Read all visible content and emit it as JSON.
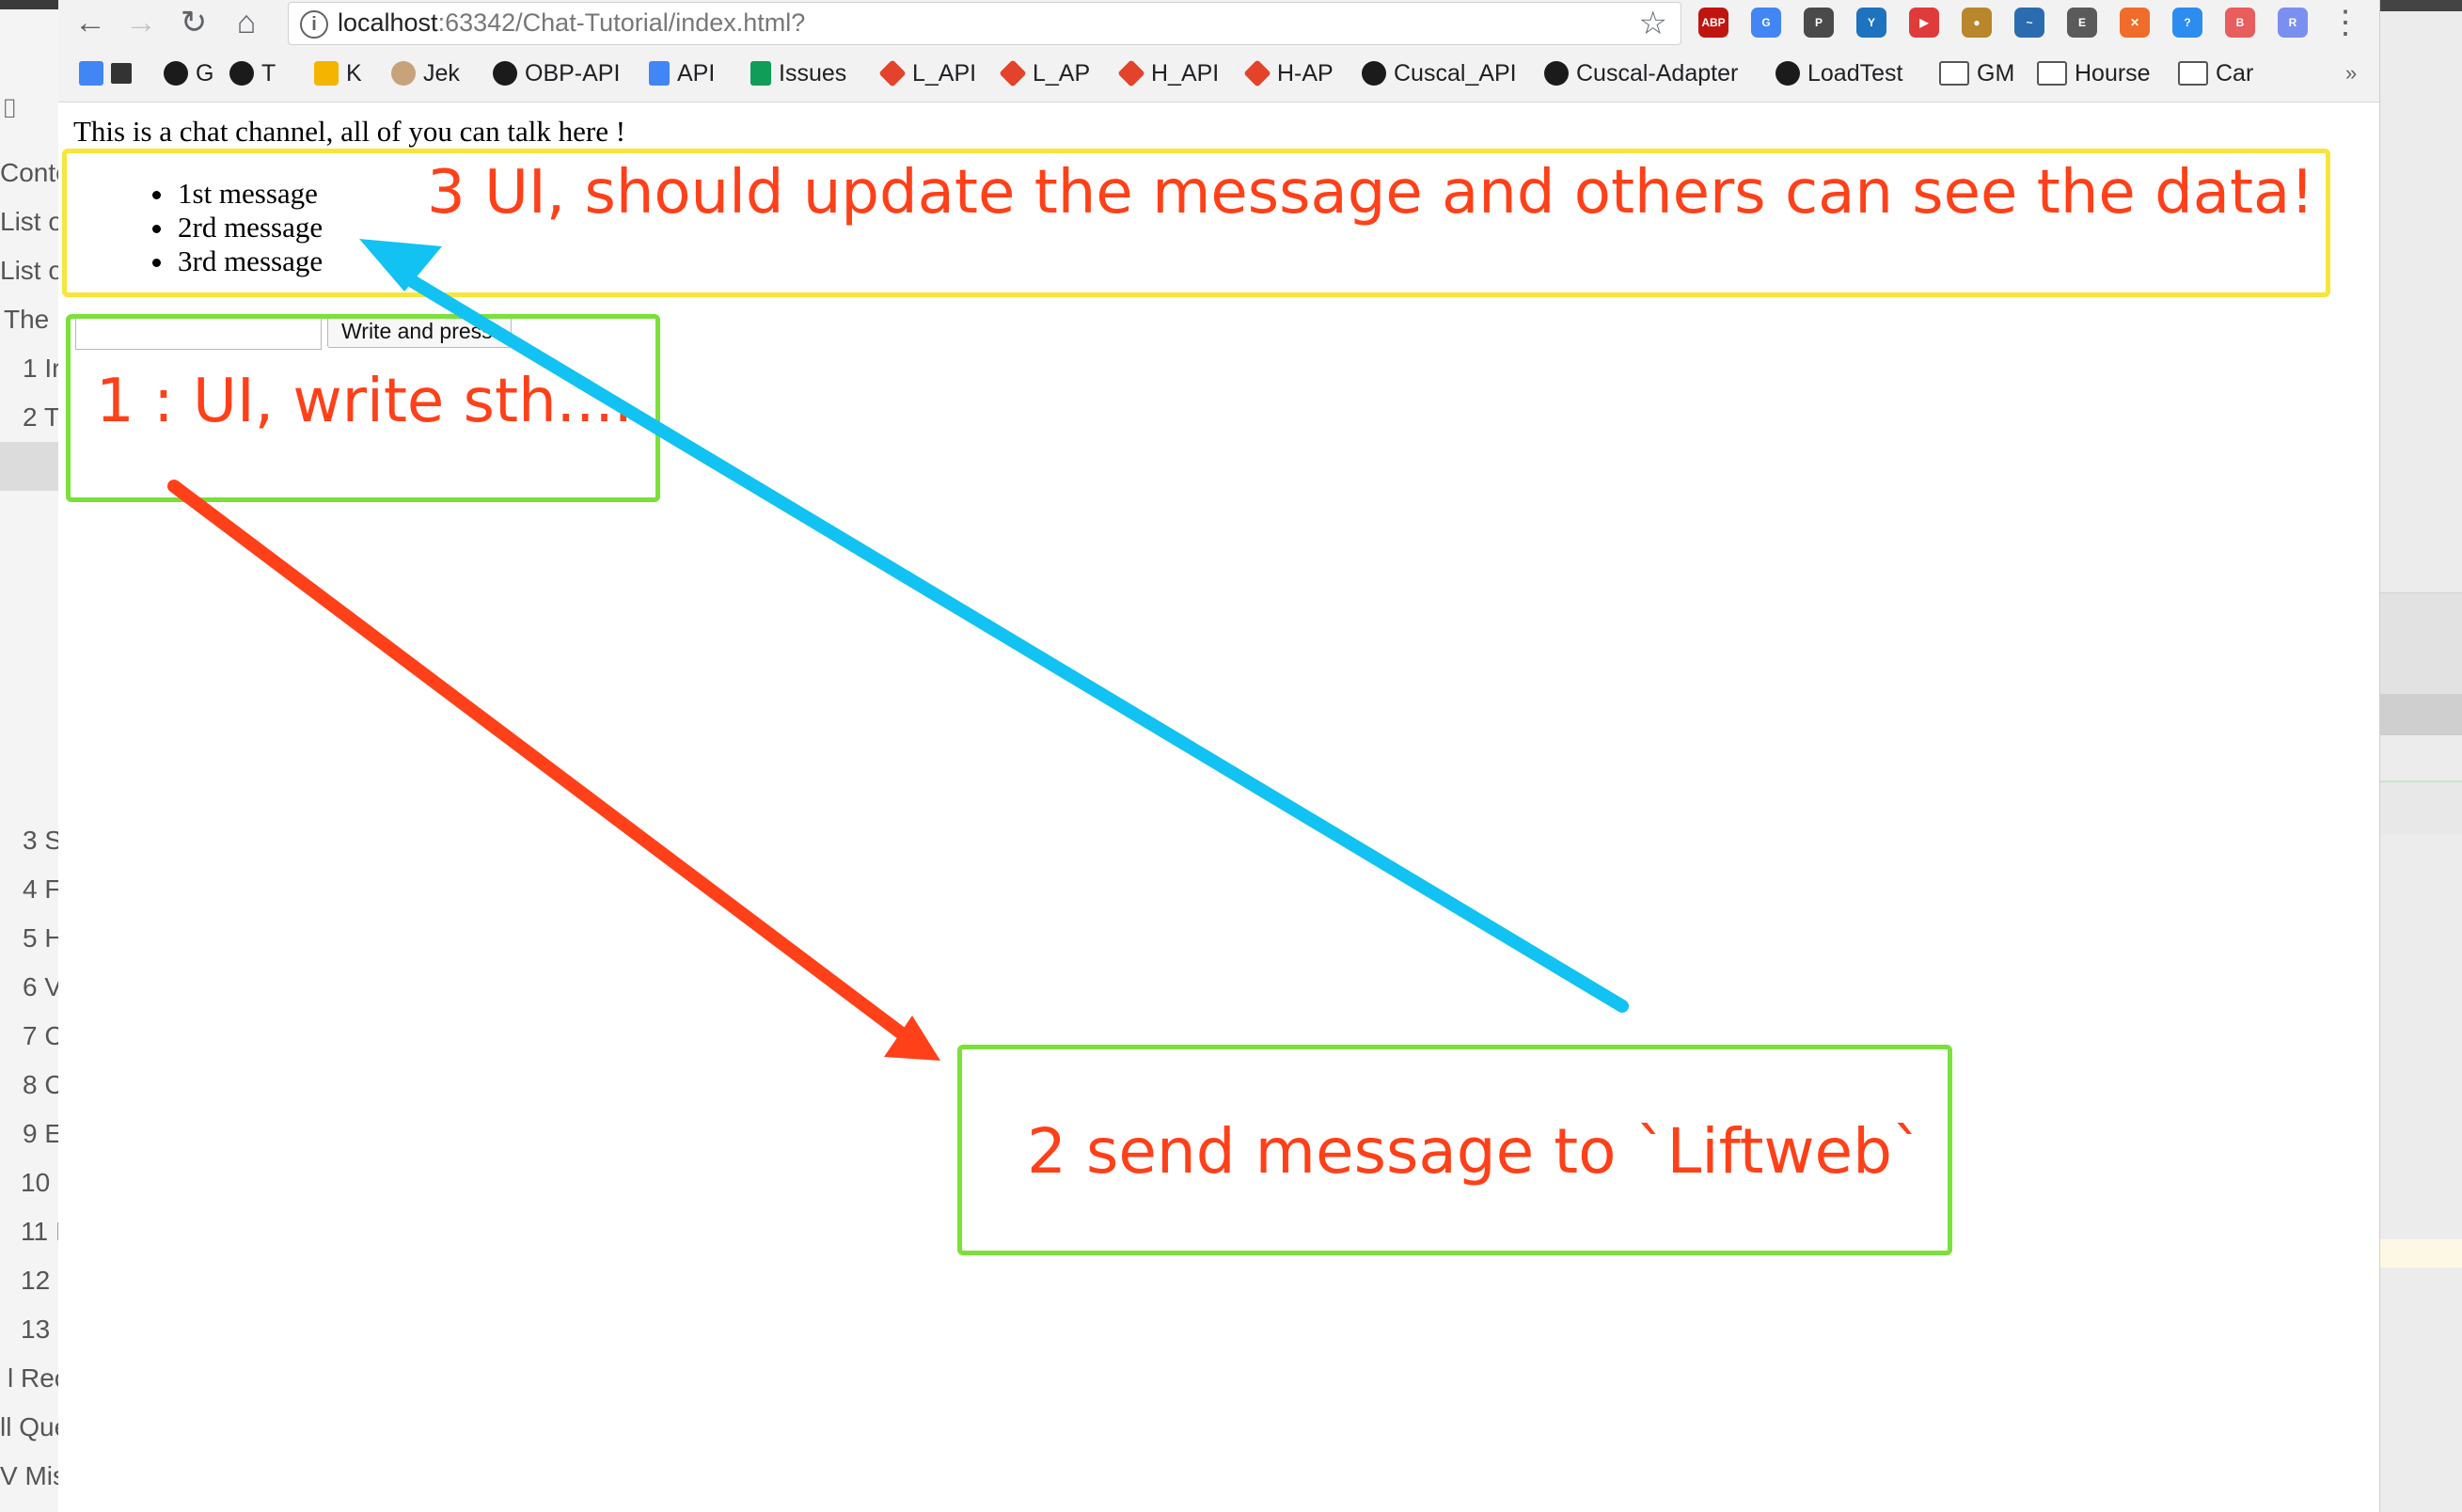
{
  "left_pane": {
    "items": [
      {
        "label": "Conte"
      },
      {
        "label": "List o"
      },
      {
        "label": "List o"
      },
      {
        "label": "The"
      },
      {
        "label": "1 Ir"
      },
      {
        "label": "2 T"
      },
      {
        "label": "3 S"
      },
      {
        "label": "4 F"
      },
      {
        "label": "5 H"
      },
      {
        "label": "6 V"
      },
      {
        "label": "7 C"
      },
      {
        "label": "8 C"
      },
      {
        "label": "9 E"
      },
      {
        "label": "10"
      },
      {
        "label": "11 I"
      },
      {
        "label": "12"
      },
      {
        "label": "13"
      },
      {
        "label": "l Reci"
      },
      {
        "label": "ll Que"
      },
      {
        "label": "V Mis"
      }
    ]
  },
  "browser": {
    "url_host": "localhost",
    "url_rest": ":63342/Chat-Tutorial/index.html?",
    "extensions": [
      {
        "label": "ABP",
        "color": "#c0150f"
      },
      {
        "label": "G",
        "color": "#4285f4"
      },
      {
        "label": "P",
        "color": "#4a4a4a"
      },
      {
        "label": "Y",
        "color": "#1e73be"
      },
      {
        "label": "▶",
        "color": "#e03b3b"
      },
      {
        "label": "●",
        "color": "#b8862b"
      },
      {
        "label": "~",
        "color": "#2b6cb0"
      },
      {
        "label": "E",
        "color": "#5a5a5a"
      },
      {
        "label": "✕",
        "color": "#ef6c2a"
      },
      {
        "label": "?",
        "color": "#2d8cf0"
      },
      {
        "label": "B",
        "color": "#e85d5d"
      },
      {
        "label": "R",
        "color": "#7b8ff0"
      }
    ],
    "bookmarks": [
      {
        "label": "",
        "icon": "translate-icon"
      },
      {
        "label": "G",
        "icon": "github-icon"
      },
      {
        "label": "T",
        "icon": "github-icon"
      },
      {
        "label": "K",
        "icon": "bulb-icon"
      },
      {
        "label": "Jek",
        "icon": "jenkins-icon"
      },
      {
        "label": "OBP-API",
        "icon": "github-icon"
      },
      {
        "label": "API",
        "icon": "docs-icon"
      },
      {
        "label": "Issues",
        "icon": "sheets-icon"
      },
      {
        "label": "L_API",
        "icon": "gitlab-icon"
      },
      {
        "label": "L_AP",
        "icon": "gitlab-icon"
      },
      {
        "label": "H_API",
        "icon": "gitlab-icon"
      },
      {
        "label": "H-AP",
        "icon": "gitlab-icon"
      },
      {
        "label": "Cuscal_API",
        "icon": "github-icon"
      },
      {
        "label": "Cuscal-Adapter",
        "icon": "github-icon"
      },
      {
        "label": "LoadTest",
        "icon": "github-icon"
      },
      {
        "label": "GM",
        "icon": "folder-icon"
      },
      {
        "label": "Hourse",
        "icon": "folder-icon"
      },
      {
        "label": "Car",
        "icon": "folder-icon"
      }
    ],
    "more_label": "»"
  },
  "page": {
    "intro": "This is a chat channel, all of you can talk here !",
    "messages": [
      "1st message",
      "2rd message",
      "3rd message"
    ],
    "input_value": "",
    "send_label": "Write and press"
  },
  "annotations": {
    "step1": "1 : UI, write sth....",
    "step2": "2 send message to `Liftweb`",
    "step3": "3 UI, should update the message and others can see the data!",
    "box_yellow": "#f7e53a",
    "box_green": "#7be03a",
    "arrow_red": "#ff4019",
    "arrow_blue": "#12c2f2"
  }
}
